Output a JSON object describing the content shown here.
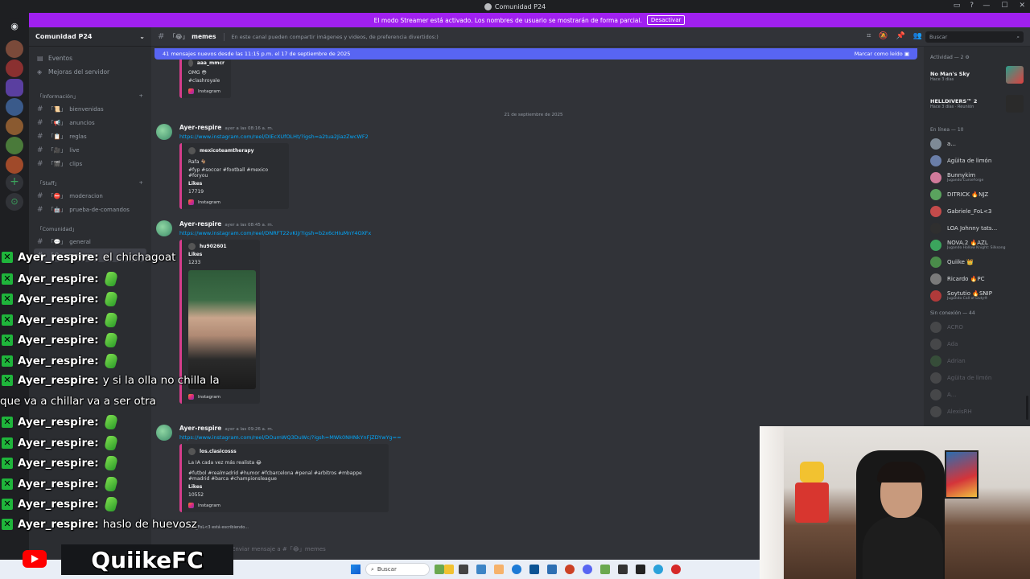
{
  "window": {
    "title": "Comunidad P24",
    "streamer_notice": "El modo Streamer está activado. Los nombres de usuario se mostrarán de forma parcial.",
    "deactivate_label": "Desactivar"
  },
  "server": {
    "name": "Comunidad P24",
    "menu": [
      {
        "label": "Eventos",
        "icon": "calendar-icon"
      },
      {
        "label": "Mejoras del servidor",
        "icon": "boost-icon"
      }
    ],
    "categories": [
      {
        "label": "「Información」",
        "channels": [
          {
            "prefix": "「📜」",
            "name": "bienvenidas"
          },
          {
            "prefix": "「📢」",
            "name": "anuncios"
          },
          {
            "prefix": "「📋」",
            "name": "reglas"
          },
          {
            "prefix": "「🎥」",
            "name": "live"
          },
          {
            "prefix": "「🎬」",
            "name": "clips"
          }
        ]
      },
      {
        "label": "「Staff」",
        "channels": [
          {
            "prefix": "「⛔」",
            "name": "moderacion"
          },
          {
            "prefix": "「🤖」",
            "name": "prueba-de-comandos"
          }
        ]
      },
      {
        "label": "「Comunidad」",
        "channels": [
          {
            "prefix": "「💬」",
            "name": "general"
          },
          {
            "prefix": "「😂」",
            "name": "memes",
            "active": true
          }
        ]
      }
    ]
  },
  "channel": {
    "prefix": "「😂」",
    "name": "memes",
    "topic": "En este canal pueden compartir imágenes y videos, de preferencia divertidos:)",
    "search_placeholder": "Buscar"
  },
  "new_messages_bar": {
    "text": "41 mensajes nuevos desde las 11:15 p.m. el 17 de septiembre de 2025",
    "mark_read": "Marcar como leído"
  },
  "date_divider": "21 de septiembre de 2025",
  "messages": [
    {
      "partial": true,
      "embed": {
        "author": "aaa_mmcr",
        "lines": [
          "OMG 😳",
          "#clashroyale"
        ],
        "footer": "Instagram"
      }
    },
    {
      "author": "Ayer-respire",
      "timestamp": "ayer a las 08:16 a. m.",
      "link": "https://www.instagram.com/reel/DIEcXUfOLHt/?igsh=a2tua2JiazZwcWF2",
      "embed": {
        "author": "mexicoteamtherapy",
        "lines": [
          "Rafa 🐐",
          "#fyp #soccer #football #mexico #foryou"
        ],
        "likes_label": "Likes",
        "likes": "17719",
        "footer": "Instagram"
      }
    },
    {
      "author": "Ayer-respire",
      "timestamp": "ayer a las 08:45 a. m.",
      "link": "https://www.instagram.com/reel/DNRFT22vKiJ/?igsh=b2x6cHIuMnY4OXFx",
      "embed": {
        "author": "hu902601",
        "likes_label": "Likes",
        "likes": "1233",
        "footer": "Instagram"
      }
    },
    {
      "author": "Ayer-respire",
      "timestamp": "ayer a las 09:26 a. m.",
      "link": "https://www.instagram.com/reel/DOumWQ3DuWc/?igsh=MWk0NHNkYnFjZDYwYg==",
      "embed": {
        "author": "los.clasicosss",
        "lines": [
          "La IA cada vez más realista 😂",
          "#futbol #realmadrid #humor #fcbarcelona #penal #arbitros #mbappe #madrid #barca #championsleague"
        ],
        "likes_label": "Likes",
        "likes": "10552",
        "footer": "Instagram"
      }
    }
  ],
  "typing_indicator": "Gabriele_FoL<3 está escribiendo...",
  "composer_placeholder": "Enviar mensaje a #「😂」memes",
  "members": {
    "activity_header": "Actividad — 2",
    "activities": [
      {
        "game": "No Man's Sky",
        "ago": "Hace 3 días"
      },
      {
        "game": "HELLDIVERS™ 2",
        "ago": "Hace 3 días · Reunión"
      }
    ],
    "online_header": "En línea — 10",
    "online": [
      {
        "name": "a...",
        "color": "#7e8a96"
      },
      {
        "name": "Agüita de limón",
        "color": "#6a7ea8"
      },
      {
        "name": "Bunnykim",
        "sub": "Jugando CurseForge",
        "color": "#d07a9a"
      },
      {
        "name": "DITRICK 🔥NJZ",
        "color": "#5aa35e"
      },
      {
        "name": "Gabriele_FoL<3",
        "color": "#c44b4b"
      },
      {
        "name": "LOA Johnny tats...",
        "color": "#2f2f2f"
      },
      {
        "name": "NOVA.2 🔥AZL",
        "sub": "Jugando Hollow Knight: Silksong",
        "color": "#3ba55d"
      },
      {
        "name": "Quiike 👑",
        "color": "#4a8c4a"
      },
      {
        "name": "Ricardo 🔥PC",
        "color": "#7a7a7a"
      },
      {
        "name": "Soytutio 🔥SNIP",
        "sub": "Jugando Call of Duty®",
        "color": "#b03a3a"
      }
    ],
    "offline_header": "Sin conexión — 44",
    "offline": [
      {
        "name": "ACRO",
        "color": "#777"
      },
      {
        "name": "Ada",
        "color": "#777"
      },
      {
        "name": "Adrian",
        "color": "#4a8a4a"
      },
      {
        "name": "Agüita de limón",
        "color": "#777"
      },
      {
        "name": "A...",
        "color": "#777"
      },
      {
        "name": "AlexisRH",
        "color": "#777"
      }
    ]
  },
  "stream_chat": [
    {
      "user": "Ayer_respire:",
      "text": "el chichagoat"
    },
    {
      "user": "Ayer_respire:",
      "text": "",
      "emote": true
    },
    {
      "user": "Ayer_respire:",
      "text": "",
      "emote": true
    },
    {
      "user": "Ayer_respire:",
      "text": "",
      "emote": true
    },
    {
      "user": "Ayer_respire:",
      "text": "",
      "emote": true
    },
    {
      "user": "Ayer_respire:",
      "text": "",
      "emote": true
    },
    {
      "user": "Ayer_respire:",
      "text": "y si la olla no chilla la"
    },
    {
      "user": "",
      "text": "que va a chillar va a ser otra"
    },
    {
      "user": "Ayer_respire:",
      "text": "",
      "emote": true
    },
    {
      "user": "Ayer_respire:",
      "text": "",
      "emote": true
    },
    {
      "user": "Ayer_respire:",
      "text": "",
      "emote": true
    },
    {
      "user": "Ayer_respire:",
      "text": "",
      "emote": true
    },
    {
      "user": "Ayer_respire:",
      "text": "",
      "emote": true
    },
    {
      "user": "Ayer_respire:",
      "text": "haslo de huevosz"
    }
  ],
  "brand": {
    "name": "QuiikeFC"
  },
  "taskbar": {
    "search_label": "Buscar"
  },
  "colors": {
    "streamer_banner": "#a020f0",
    "blurple": "#5865f2",
    "chat_badge": "#1fb53b",
    "embed_border": "#d63d8c"
  }
}
